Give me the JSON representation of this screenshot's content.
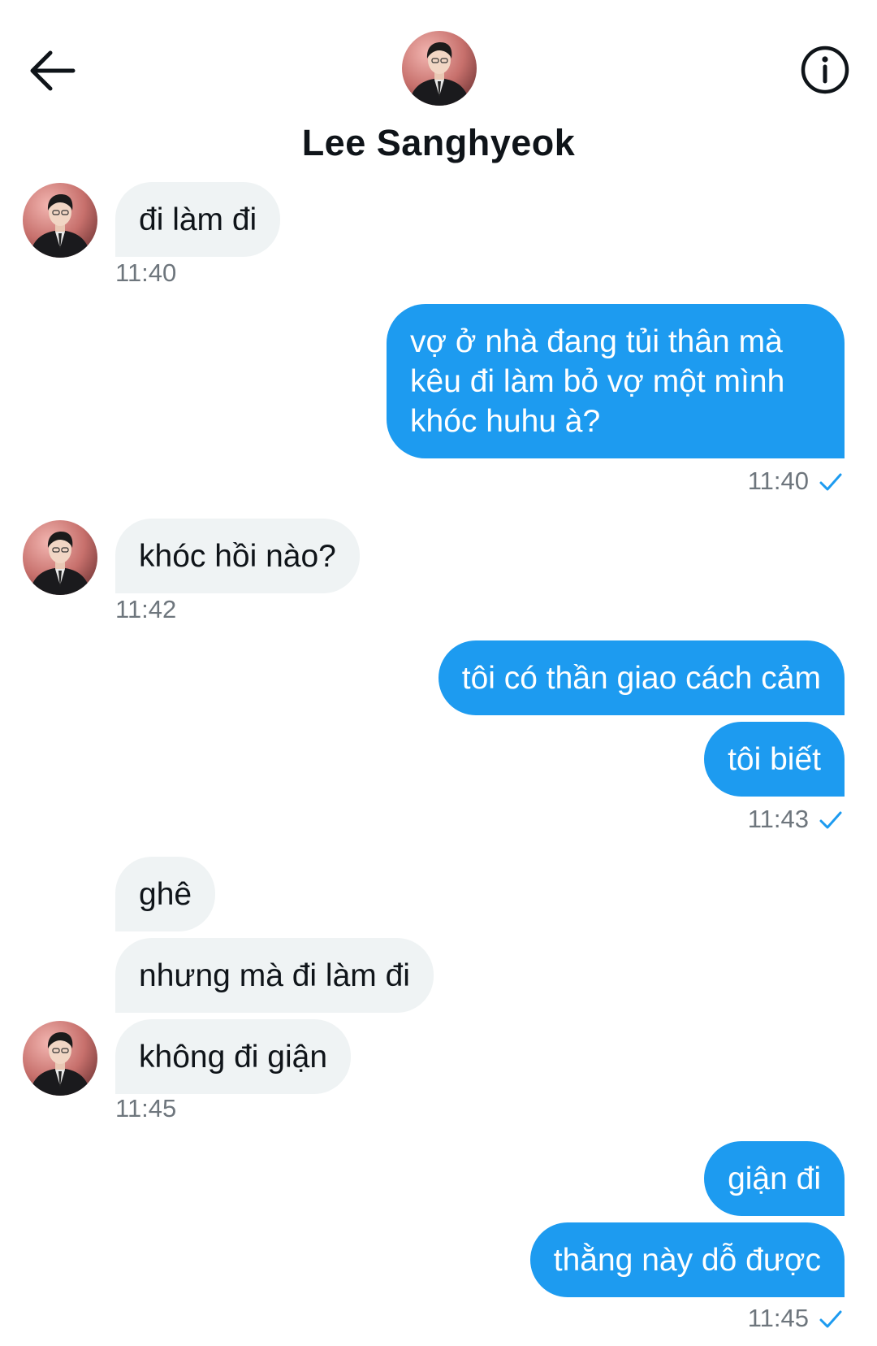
{
  "header": {
    "contact_name": "Lee Sanghyeok",
    "back_icon": "arrow-left-icon",
    "info_icon": "info-circle-icon"
  },
  "colors": {
    "outgoing_bubble": "#1d9bf0",
    "incoming_bubble": "#eff3f4",
    "timestamp": "#6e767d",
    "read_check": "#1d9bf0"
  },
  "messages": [
    {
      "side": "in",
      "text": "đi làm đi"
    },
    {
      "side": "in",
      "time": "11:40"
    },
    {
      "side": "out",
      "text": "vợ ở nhà đang tủi thân mà kêu đi làm bỏ vợ một mình khóc huhu à?"
    },
    {
      "side": "out",
      "time": "11:40"
    },
    {
      "side": "in",
      "text": "khóc hồi nào?"
    },
    {
      "side": "in",
      "time": "11:42"
    },
    {
      "side": "out",
      "text": "tôi có thần giao cách cảm"
    },
    {
      "side": "out",
      "text": "tôi biết"
    },
    {
      "side": "out",
      "time": "11:43"
    },
    {
      "side": "in",
      "text": "ghê"
    },
    {
      "side": "in",
      "text": "nhưng mà đi làm đi"
    },
    {
      "side": "in",
      "text": "không đi giận"
    },
    {
      "side": "in",
      "time": "11:45"
    },
    {
      "side": "out",
      "text": "giận đi"
    },
    {
      "side": "out",
      "text": "thằng này dỗ được"
    },
    {
      "side": "out",
      "time": "11:45"
    }
  ]
}
